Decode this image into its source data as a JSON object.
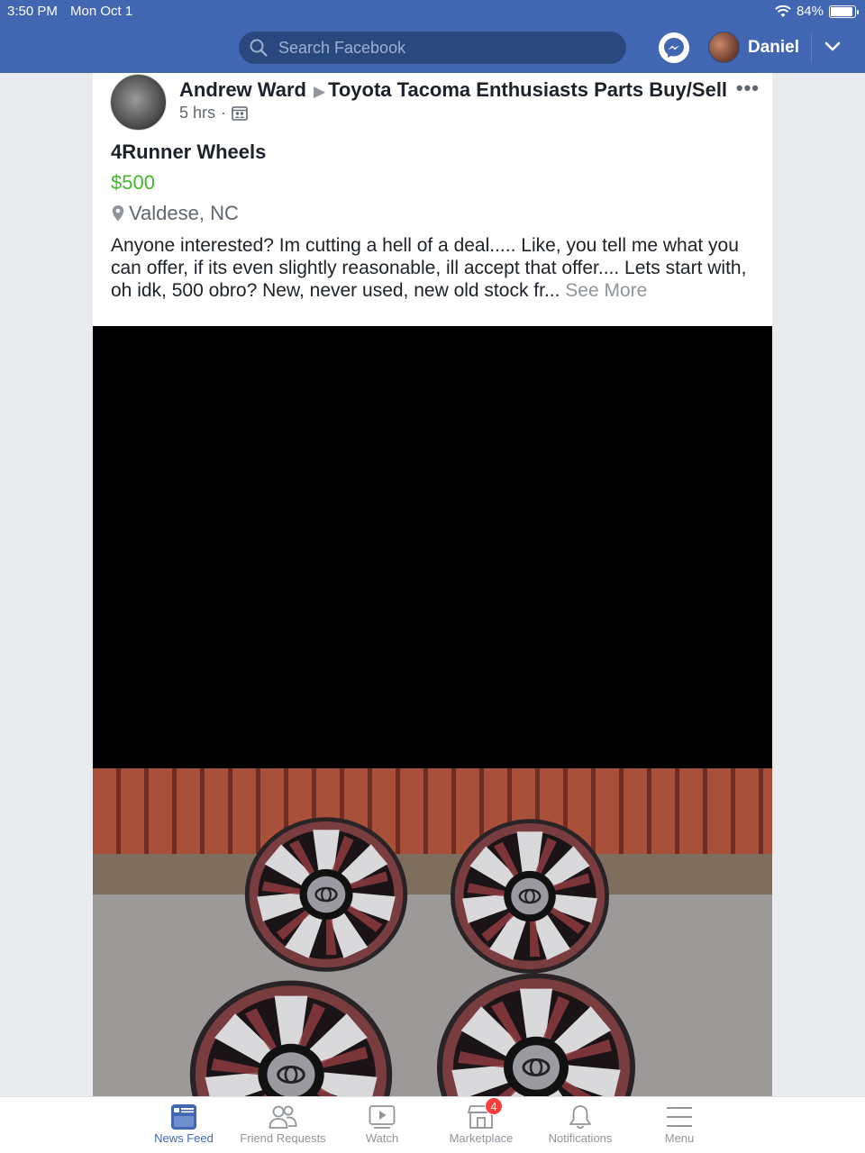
{
  "status_bar": {
    "time": "3:50 PM",
    "date": "Mon Oct 1",
    "battery": "84%",
    "battery_level": 0.84
  },
  "header": {
    "search_placeholder": "Search Facebook",
    "user_name": "Daniel"
  },
  "post": {
    "author": "Andrew Ward",
    "group": "Toyota Tacoma Enthusiasts Parts Buy/Sell",
    "time_ago": "5 hrs",
    "separator": "·",
    "listing_title": "4Runner Wheels",
    "price": "$500",
    "location": "Valdese, NC",
    "body": "Anyone interested?   Im cutting a hell of a deal.....  Like, you tell me what you can offer, if its even slightly reasonable, ill accept that offer....  Lets start with, oh idk, 500 obro?  New, never used, new old stock fr...",
    "see_more": "See More"
  },
  "tabs": [
    {
      "label": "News Feed",
      "icon": "news-feed-icon",
      "active": true
    },
    {
      "label": "Friend Requests",
      "icon": "friend-requests-icon"
    },
    {
      "label": "Watch",
      "icon": "watch-icon"
    },
    {
      "label": "Marketplace",
      "icon": "marketplace-icon",
      "badge": "4"
    },
    {
      "label": "Notifications",
      "icon": "bell-icon"
    },
    {
      "label": "Menu",
      "icon": "menu-icon"
    }
  ],
  "colors": {
    "brand": "#4267b2",
    "price": "#42b72a",
    "badge": "#fa3e3e"
  }
}
